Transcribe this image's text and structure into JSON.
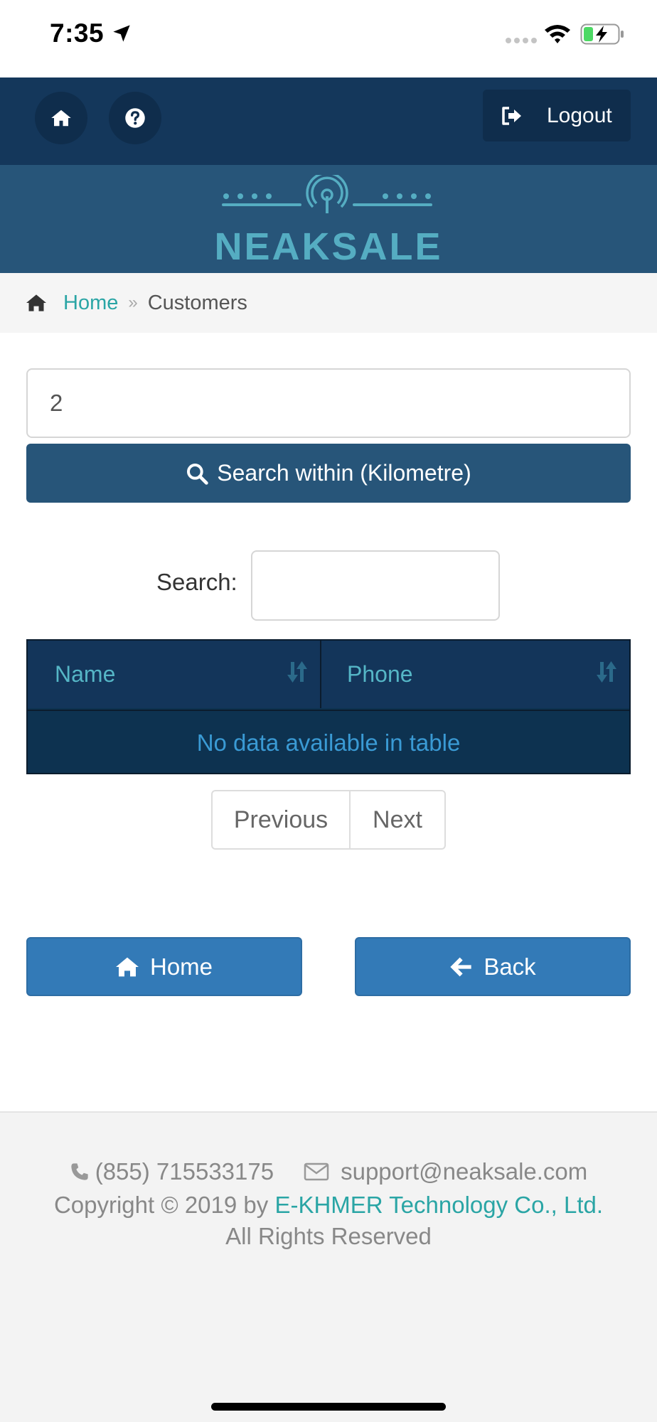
{
  "status_bar": {
    "time": "7:35",
    "icons": [
      "location-arrow-icon",
      "cellular-dots-icon",
      "wifi-icon",
      "battery-charging-icon"
    ]
  },
  "topnav": {
    "home_icon": "home-icon",
    "help_icon": "question-circle-icon",
    "logout_label": "Logout",
    "logout_icon": "sign-out-icon"
  },
  "brand": {
    "name": "NEAKSALE",
    "logo_icon": "signal-tower-logo"
  },
  "breadcrumb": {
    "home_label": "Home",
    "separator": "»",
    "current": "Customers"
  },
  "distance_search": {
    "value": "2",
    "button_label": "Search within (Kilometre)"
  },
  "table_search": {
    "label": "Search:",
    "value": ""
  },
  "table": {
    "columns": [
      "Name",
      "Phone"
    ],
    "empty_message": "No data available in table"
  },
  "pagination": {
    "previous_label": "Previous",
    "next_label": "Next"
  },
  "actions": {
    "home_label": "Home",
    "back_label": "Back"
  },
  "footer": {
    "phone": "(855) 715533175",
    "email": "support@neaksale.com",
    "copyright_prefix": "Copyright © 2019 by ",
    "company": "E-KHMER Technology Co., Ltd.",
    "rights": "All Rights Reserved"
  },
  "colors": {
    "nav_dark": "#14375b",
    "brand_band": "#275579",
    "accent_teal": "#2aa5a5",
    "primary_blue": "#337ab7"
  }
}
